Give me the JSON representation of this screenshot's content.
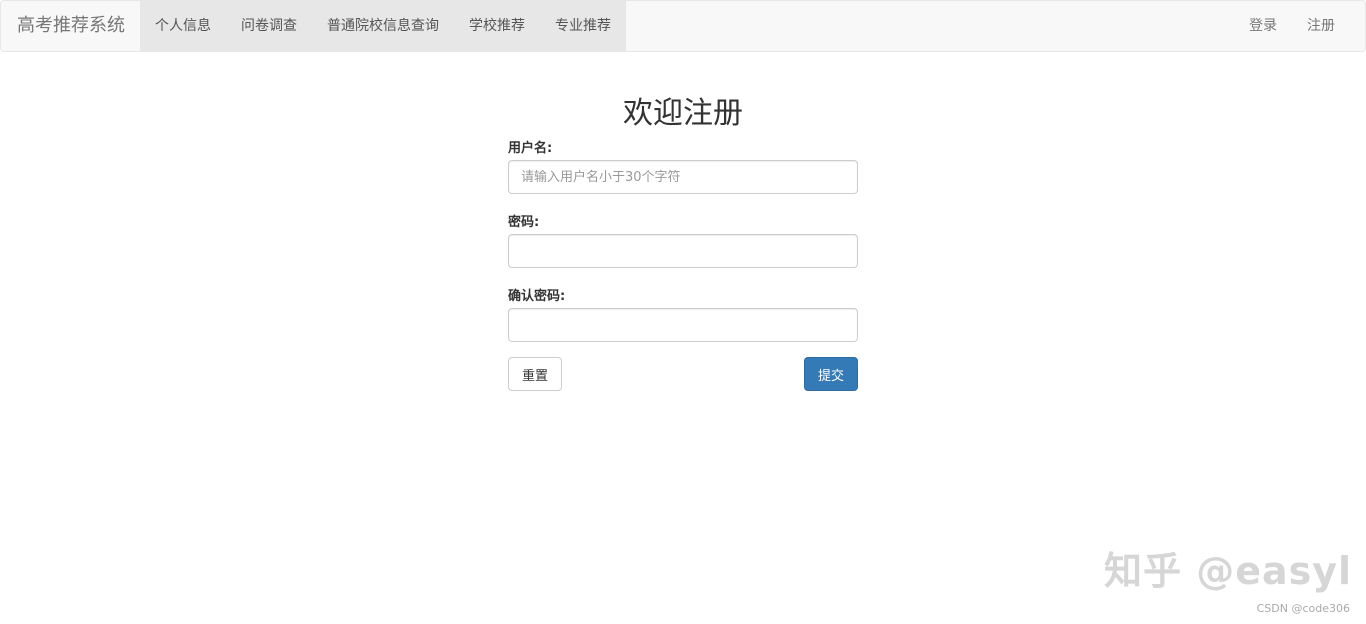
{
  "navbar": {
    "brand": "高考推荐系统",
    "left_items": [
      {
        "label": "个人信息"
      },
      {
        "label": "问卷调查"
      },
      {
        "label": "普通院校信息查询"
      },
      {
        "label": "学校推荐"
      },
      {
        "label": "专业推荐"
      }
    ],
    "right_items": [
      {
        "label": "登录"
      },
      {
        "label": "注册"
      }
    ]
  },
  "form": {
    "title": "欢迎注册",
    "username_label": "用户名:",
    "username_placeholder": "请输入用户名小于30个字符",
    "username_value": "",
    "password_label": "密码:",
    "password_value": "",
    "confirm_label": "确认密码:",
    "confirm_value": "",
    "reset_label": "重置",
    "submit_label": "提交"
  },
  "colors": {
    "primary": "#337ab7",
    "navbar_bg": "#f8f8f8",
    "nav_active_bg": "#e7e7e7"
  },
  "watermark": "知乎 @easyl",
  "credit": "CSDN @code306"
}
